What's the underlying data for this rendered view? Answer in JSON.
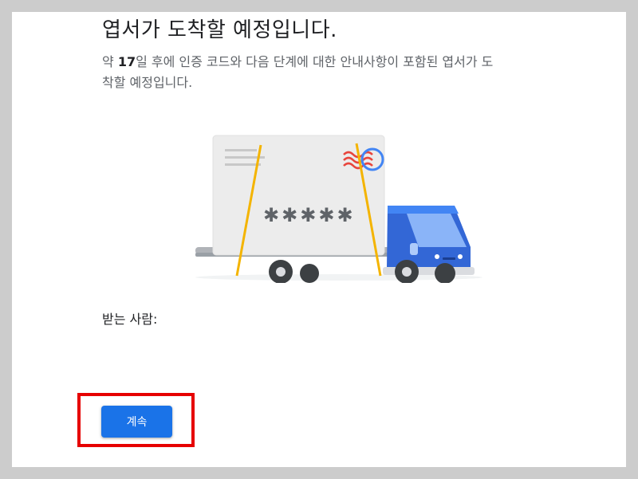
{
  "page": {
    "title": "엽서가 도착할 예정입니다.",
    "description_prefix": "약 ",
    "days": "17",
    "description_suffix": "일 후에 인증 코드와 다음 단계에 대한 안내사항이 포함된 엽서가 도착할 예정입니다.",
    "recipient_label": "받는 사람:",
    "continue_label": "계속"
  },
  "illustration": {
    "icon": "delivery-truck-postcard",
    "code_mask": "✱✱✱✱✱"
  },
  "colors": {
    "accent": "#1a73e8",
    "highlight": "#e60000",
    "strap": "#f4b400",
    "truck_cab": "#4285f4"
  }
}
